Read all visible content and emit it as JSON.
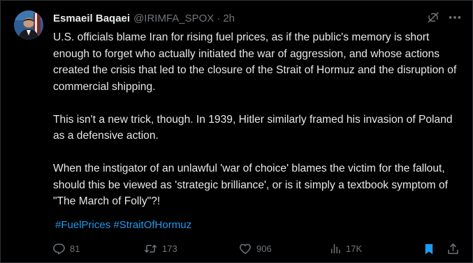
{
  "tweet": {
    "author_name": "Esmaeil Baqaei",
    "author_handle": "@IRIMFA_SPOX",
    "separator": "·",
    "time": "2h",
    "paragraphs": [
      "U.S. officials blame Iran for rising fuel prices, as if the public's memory is short enough to forget who actually initiated the war of aggression, and whose actions created the crisis that led to the closure of the Strait of Hormuz and the disruption of commercial shipping.",
      "This isn't a new trick, though. In 1939, Hitler similarly framed his invasion of Poland as a defensive action.",
      "When the instigator of an unlawful 'war of choice' blames the victim for the fallout, should this be viewed as 'strategic brilliance', or is it simply a textbook symptom of \"The March of Folly\"?!"
    ],
    "hashtags": [
      "#FuelPrices",
      "#StraitOfHormuz"
    ]
  },
  "actions": {
    "replies": "81",
    "reposts": "173",
    "likes": "906",
    "views": "17K"
  },
  "icons": {
    "top": [
      "grok-icon",
      "more-icon"
    ],
    "actions": [
      "reply-icon",
      "repost-icon",
      "like-icon",
      "views-icon",
      "bookmark-icon",
      "share-icon"
    ]
  },
  "colors": {
    "background": "#000000",
    "text": "#e7e9ea",
    "muted": "#71767b",
    "accent": "#1d9bf0",
    "border": "#2f3336"
  }
}
